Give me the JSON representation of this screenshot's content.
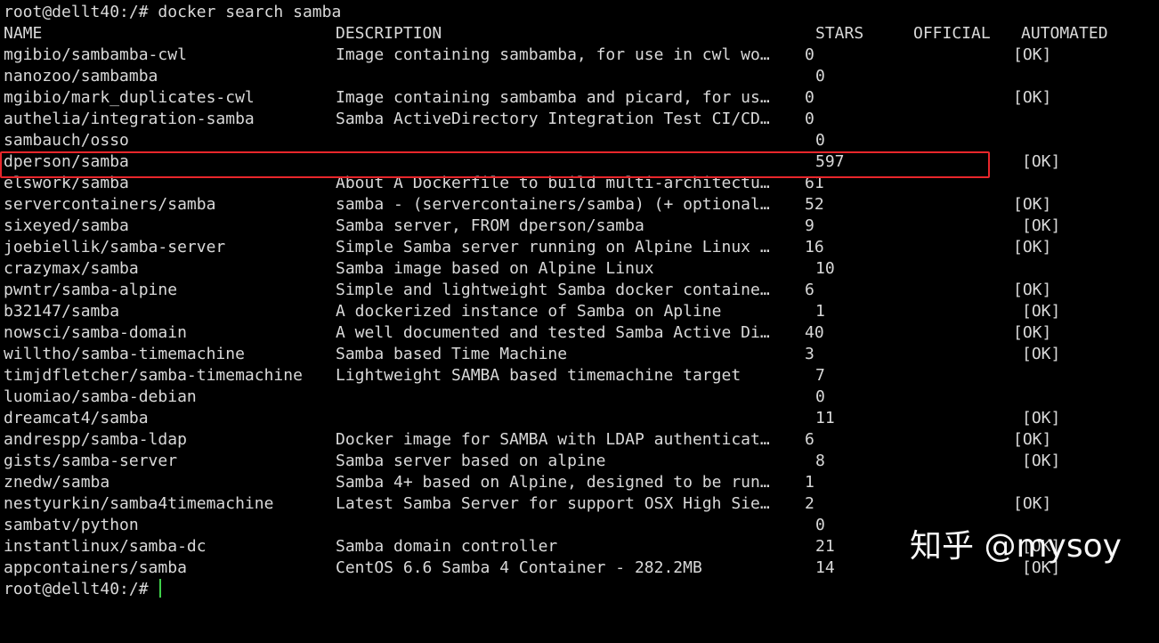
{
  "prompt": {
    "text": "root@dellt40:/# docker search samba"
  },
  "headers": {
    "name": "NAME",
    "description": "DESCRIPTION",
    "stars": "STARS",
    "official": "OFFICIAL",
    "automated": "AUTOMATED"
  },
  "rows": [
    {
      "name": "mgibio/sambamba-cwl",
      "description": "Image containing sambamba, for use in cwl wo…",
      "stars": "0",
      "automated": "[OK]"
    },
    {
      "name": "nanozoo/sambamba",
      "description": "",
      "stars": "0",
      "automated": ""
    },
    {
      "name": "mgibio/mark_duplicates-cwl",
      "description": "Image containing sambamba and picard, for us…",
      "stars": "0",
      "automated": "[OK]"
    },
    {
      "name": "authelia/integration-samba",
      "description": "Samba ActiveDirectory Integration Test CI/CD…",
      "stars": "0",
      "automated": ""
    },
    {
      "name": "sambauch/osso",
      "description": "",
      "stars": "0",
      "automated": ""
    },
    {
      "name": "dperson/samba",
      "description": "",
      "stars": "597",
      "automated": "[OK]"
    },
    {
      "name": "elswork/samba",
      "description": "About A Dockerfile to build multi-architectu…",
      "stars": "61",
      "automated": ""
    },
    {
      "name": "servercontainers/samba",
      "description": "samba - (servercontainers/samba) (+ optional…",
      "stars": "52",
      "automated": "[OK]"
    },
    {
      "name": "sixeyed/samba",
      "description": "Samba server, FROM dperson/samba",
      "stars": "9",
      "automated": "[OK]"
    },
    {
      "name": "joebiellik/samba-server",
      "description": "Simple Samba server running on Alpine Linux …",
      "stars": "16",
      "automated": "[OK]"
    },
    {
      "name": "crazymax/samba",
      "description": "Samba image based on Alpine Linux",
      "stars": "10",
      "automated": ""
    },
    {
      "name": "pwntr/samba-alpine",
      "description": "Simple and lightweight Samba docker containe…",
      "stars": "6",
      "automated": "[OK]"
    },
    {
      "name": "b32147/samba",
      "description": "A dockerized instance of Samba on Apline",
      "stars": "1",
      "automated": "[OK]"
    },
    {
      "name": "nowsci/samba-domain",
      "description": "A well documented and tested Samba Active Di…",
      "stars": "40",
      "automated": "[OK]"
    },
    {
      "name": "willtho/samba-timemachine",
      "description": "Samba based Time Machine",
      "stars": "3",
      "automated": "[OK]"
    },
    {
      "name": "timjdfletcher/samba-timemachine",
      "description": "Lightweight SAMBA based timemachine target",
      "stars": "7",
      "automated": ""
    },
    {
      "name": "luomiao/samba-debian",
      "description": "",
      "stars": "0",
      "automated": ""
    },
    {
      "name": "dreamcat4/samba",
      "description": "",
      "stars": "11",
      "automated": "[OK]"
    },
    {
      "name": "andrespp/samba-ldap",
      "description": "Docker image for SAMBA with LDAP authenticat…",
      "stars": "6",
      "automated": "[OK]"
    },
    {
      "name": "gists/samba-server",
      "description": "Samba server based on alpine",
      "stars": "8",
      "automated": "[OK]"
    },
    {
      "name": "znedw/samba",
      "description": "Samba 4+ based on Alpine, designed to be run…",
      "stars": "1",
      "automated": ""
    },
    {
      "name": "nestyurkin/samba4timemachine",
      "description": "Latest Samba Server for support OSX High Sie…",
      "stars": "2",
      "automated": "[OK]"
    },
    {
      "name": "sambatv/python",
      "description": "",
      "stars": "0",
      "automated": ""
    },
    {
      "name": "instantlinux/samba-dc",
      "description": "Samba domain controller",
      "stars": "21",
      "automated": "[OK]"
    },
    {
      "name": "appcontainers/samba",
      "description": "CentOS 6.6 Samba 4 Container - 282.2MB",
      "stars": "14",
      "automated": "[OK]"
    }
  ],
  "prompt_end": {
    "text": "root@dellt40:/# "
  },
  "watermark": {
    "text": "知乎 @mysoy"
  },
  "colors": {
    "highlight": "#e8262b",
    "cursor": "#3fd14a",
    "text": "#d9d9d9",
    "background": "#000000"
  }
}
